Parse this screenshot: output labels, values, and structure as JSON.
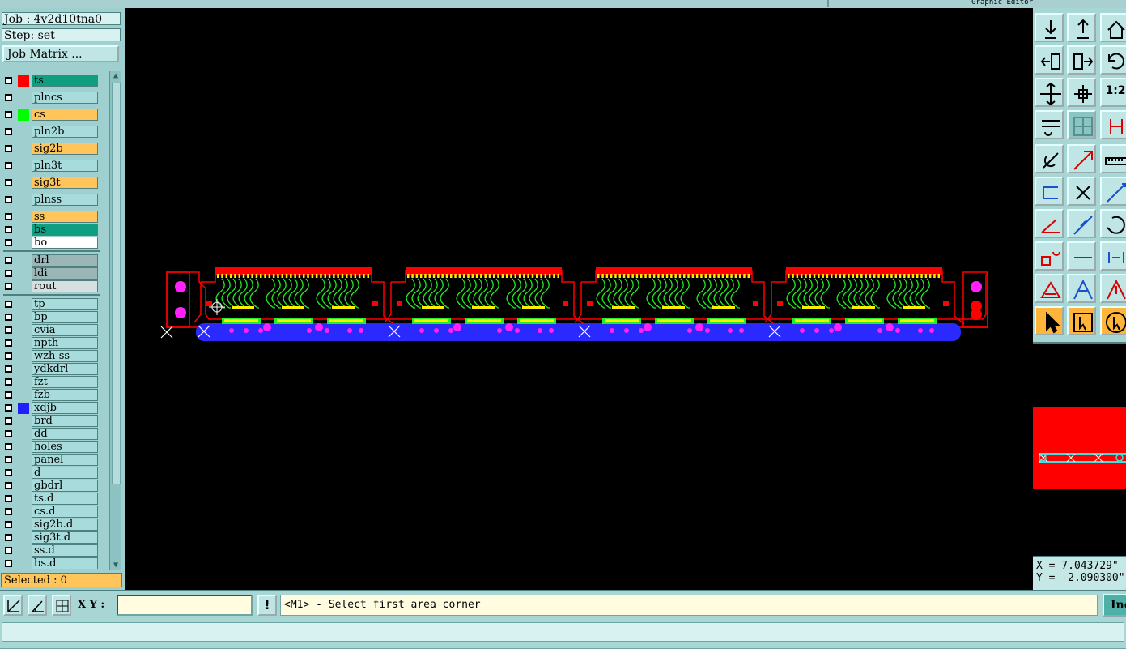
{
  "window": {
    "title_partial": "Graphic Editor"
  },
  "left_panel": {
    "job_label": "Job : 4v2d10tna0",
    "step_label": "Step: set",
    "job_matrix_button": "Job Matrix ...",
    "layers": [
      {
        "name": "ts",
        "color": "teal",
        "swatch": "#ff0000"
      },
      {
        "name": "plncs",
        "color": "default",
        "swatch": ""
      },
      {
        "name": "cs",
        "color": "orange",
        "swatch": "#00ff00"
      },
      {
        "name": "pln2b",
        "color": "default",
        "swatch": ""
      },
      {
        "name": "sig2b",
        "color": "orange",
        "swatch": ""
      },
      {
        "name": "pln3t",
        "color": "default",
        "swatch": ""
      },
      {
        "name": "sig3t",
        "color": "orange",
        "swatch": ""
      },
      {
        "name": "plnss",
        "color": "default",
        "swatch": ""
      },
      {
        "name": "ss",
        "color": "orange",
        "swatch": ""
      },
      {
        "name": "bs",
        "color": "teal",
        "swatch": ""
      },
      {
        "name": "bo",
        "color": "white",
        "swatch": ""
      },
      {
        "name": "drl",
        "color": "gray",
        "swatch": ""
      },
      {
        "name": "ldi",
        "color": "gray",
        "swatch": ""
      },
      {
        "name": "rout",
        "color": "lgray",
        "swatch": ""
      },
      {
        "name": "tp",
        "color": "default",
        "swatch": ""
      },
      {
        "name": "bp",
        "color": "default",
        "swatch": ""
      },
      {
        "name": "cvia",
        "color": "default",
        "swatch": ""
      },
      {
        "name": "npth",
        "color": "default",
        "swatch": ""
      },
      {
        "name": "wzh-ss",
        "color": "default",
        "swatch": ""
      },
      {
        "name": "ydkdrl",
        "color": "default",
        "swatch": ""
      },
      {
        "name": "fzt",
        "color": "default",
        "swatch": ""
      },
      {
        "name": "fzb",
        "color": "default",
        "swatch": ""
      },
      {
        "name": "xdjb",
        "color": "default",
        "swatch": "#2020ff"
      },
      {
        "name": "brd",
        "color": "default",
        "swatch": ""
      },
      {
        "name": "dd",
        "color": "default",
        "swatch": ""
      },
      {
        "name": "holes",
        "color": "default",
        "swatch": ""
      },
      {
        "name": "panel",
        "color": "default",
        "swatch": ""
      },
      {
        "name": "d",
        "color": "default",
        "swatch": ""
      },
      {
        "name": "gbdrl",
        "color": "default",
        "swatch": ""
      },
      {
        "name": "ts.d",
        "color": "default",
        "swatch": ""
      },
      {
        "name": "cs.d",
        "color": "default",
        "swatch": ""
      },
      {
        "name": "sig2b.d",
        "color": "default",
        "swatch": ""
      },
      {
        "name": "sig3t.d",
        "color": "default",
        "swatch": ""
      },
      {
        "name": "ss.d",
        "color": "default",
        "swatch": ""
      },
      {
        "name": "bs.d",
        "color": "default",
        "swatch": ""
      }
    ],
    "selected_label": "Selected : 0"
  },
  "right_panel": {
    "one_to_two_label": "1:2",
    "coord_x": "X = 7.043729\"",
    "coord_y": "Y = -2.090300\""
  },
  "bottom_bar": {
    "xy_label": "X Y :",
    "xy_value": "",
    "bang_label": "!",
    "prompt": "<M1> - Select first area corner",
    "inc_button": "Inc"
  },
  "colors": {
    "canvas_bg": "#000000",
    "copper_pad": "#ff0000",
    "trace_green": "#22ee22",
    "finger_yellow": "#ffee00",
    "via_magenta": "#ff22ff",
    "rail_blue": "#2a2aff",
    "panel_teal": "#a8d6d5",
    "highlight_orange": "#ffc55a"
  }
}
